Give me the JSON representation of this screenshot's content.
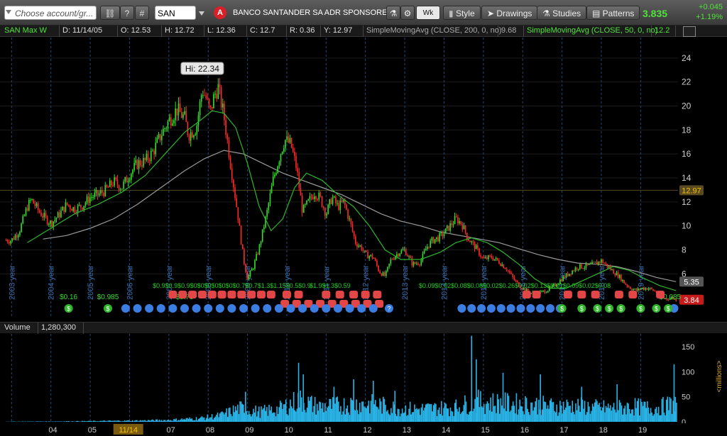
{
  "toolbar": {
    "account_placeholder": "Choose account/gr...",
    "symbol": "SAN",
    "badge": "A",
    "company": "BANCO SANTANDER SA ADR SPONSORED",
    "aggregation": "Wk",
    "style_label": "Style",
    "drawings_label": "Drawings",
    "studies_label": "Studies",
    "patterns_label": "Patterns",
    "last_price": "3.835",
    "change": "+0.045",
    "change_pct": "+1.19%",
    "hash_label": "#",
    "help_label": "?"
  },
  "status": {
    "title": "SAN Max W",
    "d": "D: 11/14/05",
    "o": "O: 12.53",
    "h": "H: 12.72",
    "l": "L: 12.36",
    "c": "C: 12.7",
    "r": "R: 0.36",
    "y": "Y: 12.97",
    "sma200_label": "SimpleMovingAvg (CLOSE, 200, 0, no)",
    "sma200_value": "9.68",
    "sma50_label": "SimpleMovingAvg (CLOSE, 50, 0, no)",
    "sma50_value": "12.2"
  },
  "volume_header": {
    "label": "Volume",
    "value": "1,280,300"
  },
  "colors": {
    "up": "#33e02a",
    "down": "#ff2a2a",
    "sma50": "#2fb52a",
    "sma200": "#9a9a9a",
    "volume": "#29b3e6",
    "grid": "#1f4a7a",
    "year_label": "#3a6fb0"
  },
  "chart_data": {
    "type": "candlestick",
    "price_axis": {
      "ticks": [
        6,
        8,
        10,
        12,
        14,
        16,
        18,
        20,
        22,
        24
      ],
      "ylim": [
        3,
        25
      ]
    },
    "volume_axis": {
      "ticks": [
        0,
        50,
        100,
        150
      ],
      "ylim": [
        0,
        170
      ],
      "label": "<millions>"
    },
    "hi_label": "Hi: 22.34",
    "hi_value": 22.34,
    "year_markers": [
      "2003 year",
      "2004 year",
      "2005 year",
      "2006 year",
      "2007 year",
      "2008 year",
      "2009 year",
      "2010 year",
      "2011 year",
      "2012 year",
      "2013 year",
      "2014 year",
      "2015 year",
      "2016 year",
      "2017 year",
      "2018 year",
      "2019 year"
    ],
    "x_tick_labels": [
      "04",
      "05",
      "11/14",
      "07",
      "08",
      "09",
      "10",
      "11",
      "12",
      "13",
      "14",
      "15",
      "16",
      "17",
      "18",
      "19"
    ],
    "price_labels": [
      {
        "value": 12.97,
        "text": "12.97",
        "bg": "#5a4a20",
        "fg": "#f2c200"
      },
      {
        "value": 5.35,
        "text": "5.35",
        "bg": "#555555",
        "fg": "#ffffff"
      },
      {
        "value": 3.84,
        "text": "3.84",
        "bg": "#c71a1a",
        "fg": "#ffffff"
      }
    ],
    "close_path": [
      [
        2003.0,
        8.8
      ],
      [
        2003.2,
        9.6
      ],
      [
        2003.4,
        11.6
      ],
      [
        2003.5,
        12.2
      ],
      [
        2003.7,
        11.2
      ],
      [
        2003.9,
        10.5
      ],
      [
        2004.0,
        10.2
      ],
      [
        2004.2,
        10.9
      ],
      [
        2004.4,
        11.8
      ],
      [
        2004.6,
        11.4
      ],
      [
        2004.8,
        11.7
      ],
      [
        2005.0,
        12.4
      ],
      [
        2005.2,
        12.6
      ],
      [
        2005.4,
        13.0
      ],
      [
        2005.6,
        13.7
      ],
      [
        2005.8,
        13.2
      ],
      [
        2006.0,
        14.3
      ],
      [
        2006.2,
        15.2
      ],
      [
        2006.4,
        15.4
      ],
      [
        2006.6,
        16.2
      ],
      [
        2006.8,
        17.6
      ],
      [
        2007.0,
        18.8
      ],
      [
        2007.2,
        19.7
      ],
      [
        2007.4,
        19.0
      ],
      [
        2007.5,
        17.6
      ],
      [
        2007.7,
        18.2
      ],
      [
        2007.85,
        21.4
      ],
      [
        2007.95,
        20.6
      ],
      [
        2008.05,
        19.4
      ],
      [
        2008.15,
        20.8
      ],
      [
        2008.25,
        21.6
      ],
      [
        2008.4,
        19.2
      ],
      [
        2008.55,
        15.6
      ],
      [
        2008.75,
        11.0
      ],
      [
        2008.9,
        7.2
      ],
      [
        2009.0,
        5.6
      ],
      [
        2009.15,
        6.6
      ],
      [
        2009.3,
        8.2
      ],
      [
        2009.5,
        11.2
      ],
      [
        2009.65,
        13.8
      ],
      [
        2009.85,
        16.2
      ],
      [
        2009.95,
        17.2
      ],
      [
        2010.1,
        16.8
      ],
      [
        2010.25,
        14.8
      ],
      [
        2010.4,
        11.2
      ],
      [
        2010.55,
        12.0
      ],
      [
        2010.7,
        12.8
      ],
      [
        2010.85,
        12.3
      ],
      [
        2011.0,
        11.0
      ],
      [
        2011.15,
        12.4
      ],
      [
        2011.3,
        11.6
      ],
      [
        2011.45,
        12.0
      ],
      [
        2011.6,
        10.4
      ],
      [
        2011.75,
        8.6
      ],
      [
        2011.9,
        8.2
      ],
      [
        2012.0,
        7.6
      ],
      [
        2012.2,
        7.4
      ],
      [
        2012.35,
        6.2
      ],
      [
        2012.5,
        5.8
      ],
      [
        2012.65,
        7.2
      ],
      [
        2012.85,
        7.8
      ],
      [
        2013.0,
        8.0
      ],
      [
        2013.2,
        6.8
      ],
      [
        2013.4,
        7.0
      ],
      [
        2013.55,
        8.2
      ],
      [
        2013.7,
        8.8
      ],
      [
        2013.85,
        9.0
      ],
      [
        2014.0,
        9.4
      ],
      [
        2014.2,
        10.2
      ],
      [
        2014.3,
        10.6
      ],
      [
        2014.45,
        10.2
      ],
      [
        2014.6,
        9.0
      ],
      [
        2014.8,
        8.2
      ],
      [
        2015.0,
        7.2
      ],
      [
        2015.2,
        7.4
      ],
      [
        2015.4,
        7.0
      ],
      [
        2015.6,
        6.4
      ],
      [
        2015.8,
        5.4
      ],
      [
        2016.0,
        4.8
      ],
      [
        2016.2,
        4.4
      ],
      [
        2016.4,
        4.4
      ],
      [
        2016.6,
        4.6
      ],
      [
        2016.8,
        5.0
      ],
      [
        2017.0,
        5.6
      ],
      [
        2017.2,
        6.1
      ],
      [
        2017.4,
        6.6
      ],
      [
        2017.6,
        6.6
      ],
      [
        2017.8,
        6.8
      ],
      [
        2018.0,
        7.1
      ],
      [
        2018.1,
        6.8
      ],
      [
        2018.3,
        6.2
      ],
      [
        2018.45,
        5.8
      ],
      [
        2018.6,
        5.2
      ],
      [
        2018.75,
        4.8
      ],
      [
        2018.9,
        4.6
      ],
      [
        2019.0,
        4.8
      ],
      [
        2019.2,
        4.8
      ],
      [
        2019.4,
        4.5
      ],
      [
        2019.5,
        4.1
      ],
      [
        2019.65,
        3.9
      ],
      [
        2019.8,
        4.0
      ],
      [
        2019.9,
        3.84
      ]
    ],
    "sma50_path": [
      [
        2003.4,
        8.6
      ],
      [
        2004.0,
        9.8
      ],
      [
        2004.6,
        11.0
      ],
      [
        2005.2,
        11.8
      ],
      [
        2005.8,
        12.8
      ],
      [
        2006.4,
        14.2
      ],
      [
        2006.9,
        16.0
      ],
      [
        2007.4,
        17.8
      ],
      [
        2007.8,
        18.8
      ],
      [
        2008.1,
        19.6
      ],
      [
        2008.4,
        19.4
      ],
      [
        2008.7,
        18.2
      ],
      [
        2009.0,
        15.2
      ],
      [
        2009.3,
        11.6
      ],
      [
        2009.6,
        9.6
      ],
      [
        2009.9,
        10.6
      ],
      [
        2010.2,
        13.2
      ],
      [
        2010.5,
        14.4
      ],
      [
        2010.9,
        13.8
      ],
      [
        2011.3,
        12.6
      ],
      [
        2011.7,
        11.6
      ],
      [
        2012.1,
        10.0
      ],
      [
        2012.5,
        8.0
      ],
      [
        2012.9,
        7.2
      ],
      [
        2013.4,
        7.2
      ],
      [
        2013.9,
        7.8
      ],
      [
        2014.3,
        8.6
      ],
      [
        2014.7,
        9.0
      ],
      [
        2015.1,
        8.6
      ],
      [
        2015.5,
        7.8
      ],
      [
        2015.9,
        6.8
      ],
      [
        2016.3,
        5.6
      ],
      [
        2016.7,
        4.8
      ],
      [
        2017.1,
        4.8
      ],
      [
        2017.5,
        5.4
      ],
      [
        2017.9,
        6.0
      ],
      [
        2018.3,
        6.6
      ],
      [
        2018.7,
        6.3
      ],
      [
        2019.1,
        5.6
      ],
      [
        2019.5,
        5.0
      ],
      [
        2019.9,
        4.6
      ]
    ],
    "sma200_path": [
      [
        2003.8,
        8.9
      ],
      [
        2004.4,
        9.2
      ],
      [
        2005.0,
        9.8
      ],
      [
        2005.6,
        10.6
      ],
      [
        2006.2,
        11.8
      ],
      [
        2006.8,
        13.2
      ],
      [
        2007.4,
        14.6
      ],
      [
        2007.9,
        15.6
      ],
      [
        2008.4,
        16.3
      ],
      [
        2008.9,
        16.0
      ],
      [
        2009.4,
        15.2
      ],
      [
        2009.9,
        14.4
      ],
      [
        2010.4,
        13.8
      ],
      [
        2010.9,
        13.2
      ],
      [
        2011.4,
        12.6
      ],
      [
        2011.9,
        11.8
      ],
      [
        2012.4,
        11.0
      ],
      [
        2012.9,
        10.4
      ],
      [
        2013.4,
        10.0
      ],
      [
        2013.9,
        9.5
      ],
      [
        2014.4,
        9.2
      ],
      [
        2014.9,
        8.9
      ],
      [
        2015.4,
        8.6
      ],
      [
        2015.9,
        8.1
      ],
      [
        2016.4,
        7.6
      ],
      [
        2016.9,
        7.2
      ],
      [
        2017.4,
        6.9
      ],
      [
        2017.9,
        6.8
      ],
      [
        2018.4,
        6.6
      ],
      [
        2018.9,
        6.2
      ],
      [
        2019.4,
        5.7
      ],
      [
        2019.9,
        5.35
      ]
    ],
    "volume_path": [
      [
        2003.0,
        0.5
      ],
      [
        2004.0,
        0.8
      ],
      [
        2005.0,
        1.5
      ],
      [
        2006.0,
        2.5
      ],
      [
        2007.0,
        4
      ],
      [
        2007.8,
        8
      ],
      [
        2008.3,
        14
      ],
      [
        2008.8,
        30
      ],
      [
        2009.3,
        22
      ],
      [
        2009.8,
        28
      ],
      [
        2010.3,
        48
      ],
      [
        2010.8,
        34
      ],
      [
        2011.3,
        36
      ],
      [
        2011.8,
        40
      ],
      [
        2012.3,
        38
      ],
      [
        2012.8,
        30
      ],
      [
        2013.3,
        28
      ],
      [
        2013.8,
        30
      ],
      [
        2014.3,
        32
      ],
      [
        2014.8,
        45
      ],
      [
        2015.3,
        42
      ],
      [
        2015.8,
        40
      ],
      [
        2016.3,
        38
      ],
      [
        2016.8,
        34
      ],
      [
        2017.3,
        36
      ],
      [
        2017.8,
        32
      ],
      [
        2018.3,
        30
      ],
      [
        2018.8,
        34
      ],
      [
        2019.3,
        30
      ],
      [
        2019.9,
        40
      ]
    ],
    "volume_spikes": [
      [
        2008.95,
        60
      ],
      [
        2010.3,
        118
      ],
      [
        2010.42,
        95
      ],
      [
        2011.2,
        70
      ],
      [
        2011.7,
        85
      ],
      [
        2012.2,
        82
      ],
      [
        2012.75,
        62
      ],
      [
        2014.7,
        172
      ],
      [
        2014.82,
        125
      ],
      [
        2015.5,
        98
      ],
      [
        2016.45,
        95
      ],
      [
        2017.5,
        70
      ],
      [
        2018.4,
        75
      ],
      [
        2019.85,
        115
      ]
    ],
    "events": {
      "dividend_labels": [
        {
          "x": 2004.45,
          "text": "$0.16"
        },
        {
          "x": 2005.45,
          "text": "$0.985"
        },
        {
          "x": 2007.4,
          "text": "$0.79"
        },
        {
          "x": 2019.75,
          "text": "$0.085"
        }
      ],
      "dividend_icons": [
        2004.45,
        2005.45,
        2017.0,
        2017.5,
        2017.9,
        2018.2,
        2018.5,
        2019.0,
        2019.4,
        2019.7
      ],
      "earnings_icons": [
        2005.9,
        2006.2,
        2006.5,
        2006.8,
        2007.1,
        2007.4,
        2007.7,
        2008.0,
        2008.3,
        2008.6,
        2008.9,
        2009.2,
        2009.5,
        2009.8,
        2010.1,
        2010.4,
        2010.7,
        2011.0,
        2011.3,
        2011.6,
        2011.9,
        2012.2,
        2014.45,
        2014.7,
        2014.95,
        2015.2,
        2015.45,
        2015.7,
        2015.95,
        2016.2,
        2016.45,
        2016.7,
        2016.95,
        2019.85
      ],
      "split_icons_top": [
        2007.1,
        2007.35,
        2007.6,
        2007.85,
        2008.1,
        2008.35,
        2008.6,
        2008.85,
        2009.1,
        2009.35,
        2009.6,
        2010.0,
        2010.3,
        2011.0,
        2011.35,
        2011.7,
        2012.0,
        2012.3,
        2016.1,
        2016.35,
        2017.15,
        2017.5,
        2017.85,
        2018.45,
        2018.8,
        2019.5
      ],
      "split_icons_bottom": [
        2009.95,
        2010.25,
        2010.55,
        2010.85,
        2011.15,
        2011.45,
        2011.75,
        2012.05,
        2012.35
      ],
      "question_x": 2012.6,
      "cluster_texts": [
        {
          "x": 2008.6,
          "text": "$0.9$0.9$0.9$0$0$0$0$0$0$0.7$0.7$1.3$1.15$0.5$0.9"
        },
        {
          "x": 2011.1,
          "text": "$1.9$1.3$0.59"
        },
        {
          "x": 2015.8,
          "text": "$0.09$0.02$0.08$0.08$0.02$0.26$0.02$0.13$0.01$0.09$0.02$0.08"
        }
      ]
    }
  }
}
